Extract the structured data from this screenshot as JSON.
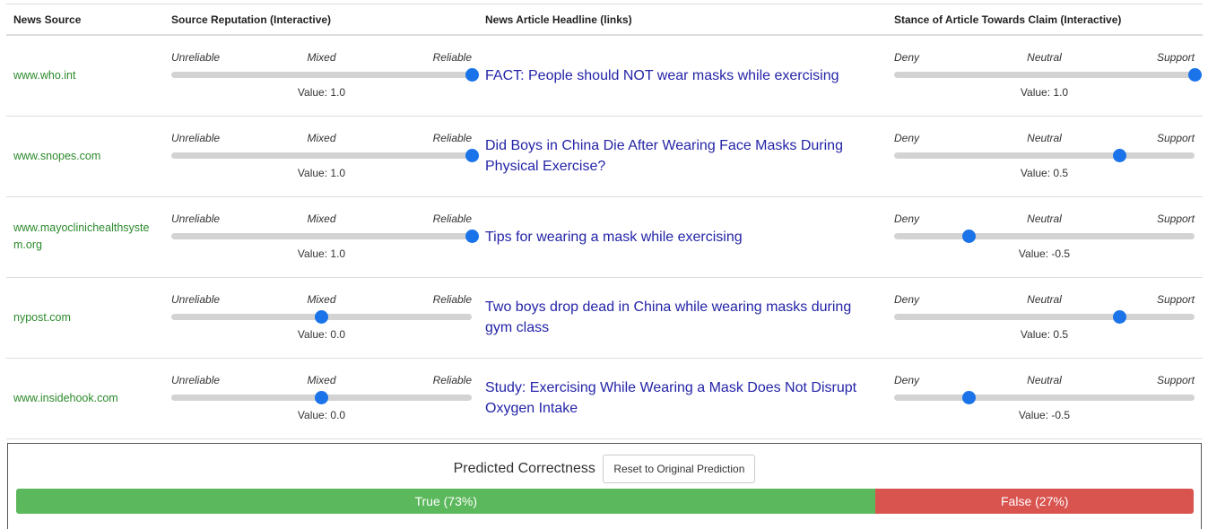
{
  "columns": {
    "source": "News Source",
    "reputation": "Source Reputation (Interactive)",
    "headline": "News Article Headline (links)",
    "stance": "Stance of Article Towards Claim (Interactive)"
  },
  "reputation_scale": {
    "left": "Unreliable",
    "middle": "Mixed",
    "right": "Reliable"
  },
  "stance_scale": {
    "left": "Deny",
    "middle": "Neutral",
    "right": "Support"
  },
  "rows": [
    {
      "source": "www.who.int",
      "reputation_value": 1.0,
      "reputation_label": "Value: 1.0",
      "headline": "FACT: People should NOT wear masks while exercising",
      "stance_value": 1.0,
      "stance_label": "Value: 1.0"
    },
    {
      "source": "www.snopes.com",
      "reputation_value": 1.0,
      "reputation_label": "Value: 1.0",
      "headline": "Did Boys in China Die After Wearing Face Masks During Physical Exercise?",
      "stance_value": 0.5,
      "stance_label": "Value: 0.5"
    },
    {
      "source": "www.mayoclinichealthsystem.org",
      "reputation_value": 1.0,
      "reputation_label": "Value: 1.0",
      "headline": "Tips for wearing a mask while exercising",
      "stance_value": -0.5,
      "stance_label": "Value: -0.5"
    },
    {
      "source": "nypost.com",
      "reputation_value": 0.0,
      "reputation_label": "Value: 0.0",
      "headline": "Two boys drop dead in China while wearing masks during gym class",
      "stance_value": 0.5,
      "stance_label": "Value: 0.5"
    },
    {
      "source": "www.insidehook.com",
      "reputation_value": 0.0,
      "reputation_label": "Value: 0.0",
      "headline": "Study: Exercising While Wearing a Mask Does Not Disrupt Oxygen Intake",
      "stance_value": -0.5,
      "stance_label": "Value: -0.5"
    }
  ],
  "prediction": {
    "title": "Predicted Correctness",
    "reset_label": "Reset to Original Prediction",
    "true_percent": 73,
    "true_label": "True (73%)",
    "false_percent": 27,
    "false_label": "False (27%)"
  },
  "colors": {
    "source_text": "#2c8a2c",
    "headline_link": "#2424a8",
    "slider_thumb": "#1a73e8",
    "slider_track": "#d3d3d3",
    "true_bar": "#5cb85c",
    "false_bar": "#d9534f"
  }
}
